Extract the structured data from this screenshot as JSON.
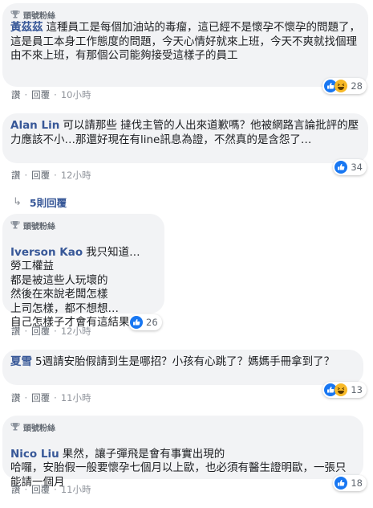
{
  "fan_badge_label": "頭號粉絲",
  "actions": {
    "like": "讚",
    "reply": "回覆",
    "sep": "·"
  },
  "comments": [
    {
      "top_fan": true,
      "author": "黃茲茲",
      "text": "這種員工是每個加油站的毒瘤，這已經不是懷孕不懷孕的問題了，這是員工本身工作態度的問題，今天心情好就來上班，今天不爽就找個理由不來上班，有那個公司能夠接受這樣子的員工",
      "time": "10小時",
      "reactions": [
        "like",
        "haha"
      ],
      "reaction_count": "28"
    },
    {
      "top_fan": false,
      "author": "Alan Lin",
      "text": "可以請那些 撻伐主管的人出來道歉嗎？他被網路言論批評的壓力應該不小…那還好現在有line訊息為證，不然真的是含怨了…",
      "time": "12小時",
      "reactions": [
        "like"
      ],
      "reaction_count": "34"
    },
    {
      "top_fan": true,
      "author": "Iverson Kao",
      "text": "我只知道…\n勞工權益\n都是被這些人玩壞的\n然後在來說老闆怎樣\n上司怎樣，都不想想…\n自己怎樣子才會有這結果…",
      "time": "12小時",
      "reactions": [
        "like"
      ],
      "reaction_count": "26"
    },
    {
      "top_fan": false,
      "author": "夏雪",
      "text": "5週請安胎假請到生是哪招？小孩有心跳了？媽媽手冊拿到了？",
      "time": "11小時",
      "reactions": [
        "like",
        "haha"
      ],
      "reaction_count": "13"
    },
    {
      "top_fan": true,
      "author": "Nico Liu",
      "text": "果然，讓子彈飛是會有事實出現的\n哈囉，安胎假一般要懷孕七個月以上歐，也必須有醫生證明歐，一張只能請一個月",
      "time": "11小時",
      "reactions": [
        "like"
      ],
      "reaction_count": "18"
    }
  ],
  "replies_link": {
    "arrow": "↳",
    "label": "5則回覆"
  },
  "colors": {
    "bubble": "#f2f3f5",
    "link": "#385898",
    "like_blue": "#1877f2",
    "haha_yellow": "#f7b928",
    "meta": "#606770"
  }
}
